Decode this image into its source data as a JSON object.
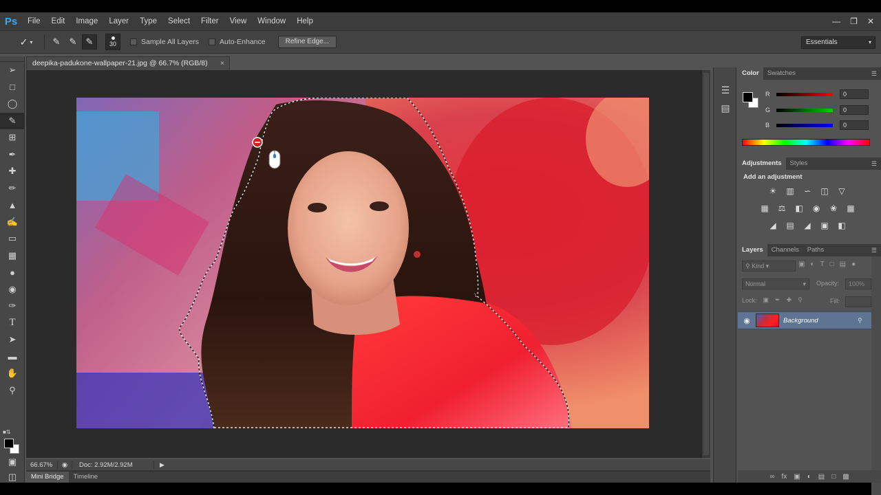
{
  "app": {
    "logo": "Ps"
  },
  "menu": [
    "File",
    "Edit",
    "Image",
    "Layer",
    "Type",
    "Select",
    "Filter",
    "View",
    "Window",
    "Help"
  ],
  "window_controls": [
    "minimize-icon",
    "restore-icon",
    "close-icon"
  ],
  "options": {
    "brush_size": "30",
    "sample_all_layers": "Sample All Layers",
    "auto_enhance": "Auto-Enhance",
    "refine_edge": "Refine Edge...",
    "workspace": "Essentials"
  },
  "document": {
    "tab_title": "deepika-padukone-wallpaper-21.jpg @ 66.7% (RGB/8)",
    "zoom": "66.67%",
    "doc_size": "Doc: 2.92M/2.92M"
  },
  "bottom_tabs": [
    "Mini Bridge",
    "Timeline"
  ],
  "color_panel": {
    "tabs": [
      "Color",
      "Swatches"
    ],
    "sliders": [
      {
        "label": "R",
        "value": "0",
        "color": "#ff0000"
      },
      {
        "label": "G",
        "value": "0",
        "color": "#00d000"
      },
      {
        "label": "B",
        "value": "0",
        "color": "#0000ff"
      }
    ]
  },
  "adjustments_panel": {
    "tabs": [
      "Adjustments",
      "Styles"
    ],
    "title": "Add an adjustment"
  },
  "layers_panel": {
    "tabs": [
      "Layers",
      "Channels",
      "Paths"
    ],
    "filter_kind": "Kind",
    "blend_mode": "Normal",
    "opacity_label": "Opacity:",
    "opacity_value": "100%",
    "lock_label": "Lock:",
    "fill_label": "Fill:",
    "layer_name": "Background"
  },
  "colors": {
    "accent": "#31a8ff",
    "selected_layer": "#5f7393",
    "panel_bg": "#535353"
  }
}
